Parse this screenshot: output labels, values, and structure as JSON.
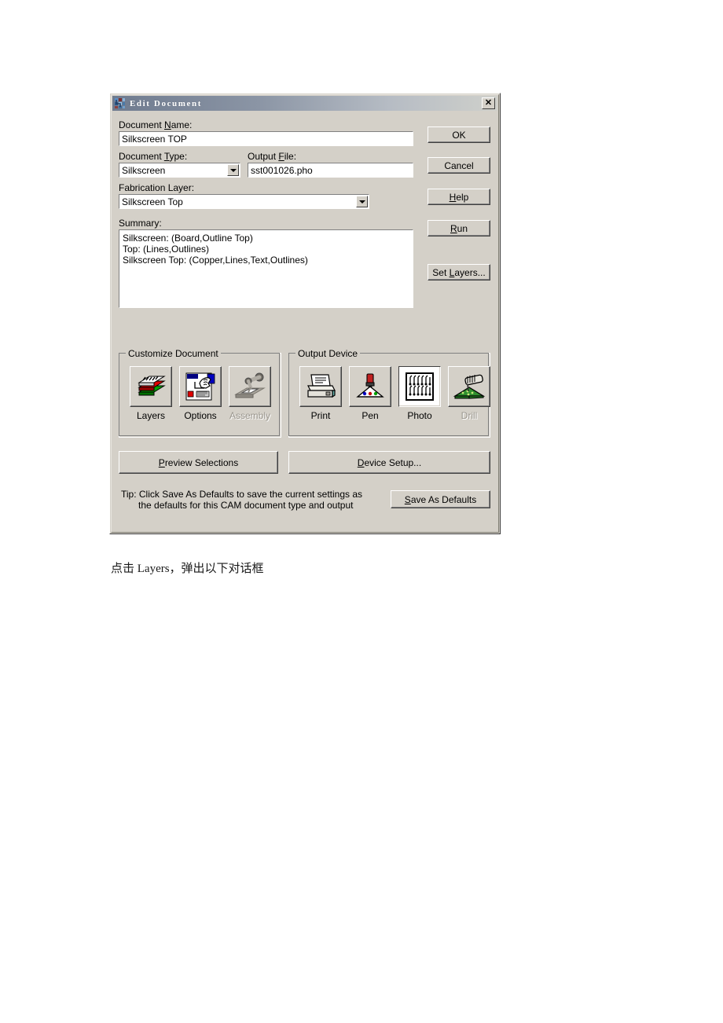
{
  "window": {
    "title": "Edit Document",
    "icon": "cam-document-icon",
    "close_label": "✕"
  },
  "form": {
    "document_name_label": "Document Name:",
    "document_name_value": "Silkscreen TOP",
    "document_type_label": "Document Type:",
    "document_type_value": "Silkscreen",
    "output_file_label": "Output File:",
    "output_file_value": "sst001026.pho",
    "fabrication_layer_label": "Fabrication Layer:",
    "fabrication_layer_value": "Silkscreen Top",
    "summary_label": "Summary:",
    "summary_lines": [
      "Silkscreen: (Board,Outline Top)",
      "Top: (Lines,Outlines)",
      "Silkscreen Top: (Copper,Lines,Text,Outlines)"
    ]
  },
  "side_buttons": [
    {
      "label": "OK",
      "name": "ok-button"
    },
    {
      "label": "Cancel",
      "name": "cancel-button"
    },
    {
      "label": "Help",
      "name": "help-button"
    },
    {
      "label": "Run",
      "name": "run-button"
    },
    {
      "label": "Set Layers...",
      "name": "set-layers-button"
    }
  ],
  "customize_document": {
    "title": "Customize Document",
    "buttons": [
      {
        "label": "Layers",
        "icon": "layers-stack-icon",
        "enabled": true,
        "selected": false
      },
      {
        "label": "Options",
        "icon": "hand-options-icon",
        "enabled": true,
        "selected": false
      },
      {
        "label": "Assembly",
        "icon": "robot-arm-icon",
        "enabled": false,
        "selected": false
      }
    ]
  },
  "output_device": {
    "title": "Output Device",
    "buttons": [
      {
        "label": "Print",
        "icon": "printer-icon",
        "enabled": true,
        "selected": false
      },
      {
        "label": "Pen",
        "icon": "pen-plotter-icon",
        "enabled": true,
        "selected": false
      },
      {
        "label": "Photo",
        "icon": "photoplotter-icon",
        "enabled": true,
        "selected": true
      },
      {
        "label": "Drill",
        "icon": "drill-icon",
        "enabled": false,
        "selected": false
      }
    ]
  },
  "bottom_buttons": {
    "preview_selections": "Preview Selections",
    "device_setup": "Device Setup...",
    "save_as_defaults": "Save As Defaults"
  },
  "tip": {
    "line1": "Tip: Click Save As Defaults to save the current settings as",
    "line2": "the defaults for this CAM document type and output"
  },
  "page_caption": "点击 Layers，弹出以下对话框",
  "colors": {
    "dialog_face": "#d4d0c8",
    "titlebar_start": "#6f7b8f",
    "titlebar_end": "#cfd0cb",
    "field_bg": "#ffffff",
    "disabled_text": "#9a968e"
  }
}
